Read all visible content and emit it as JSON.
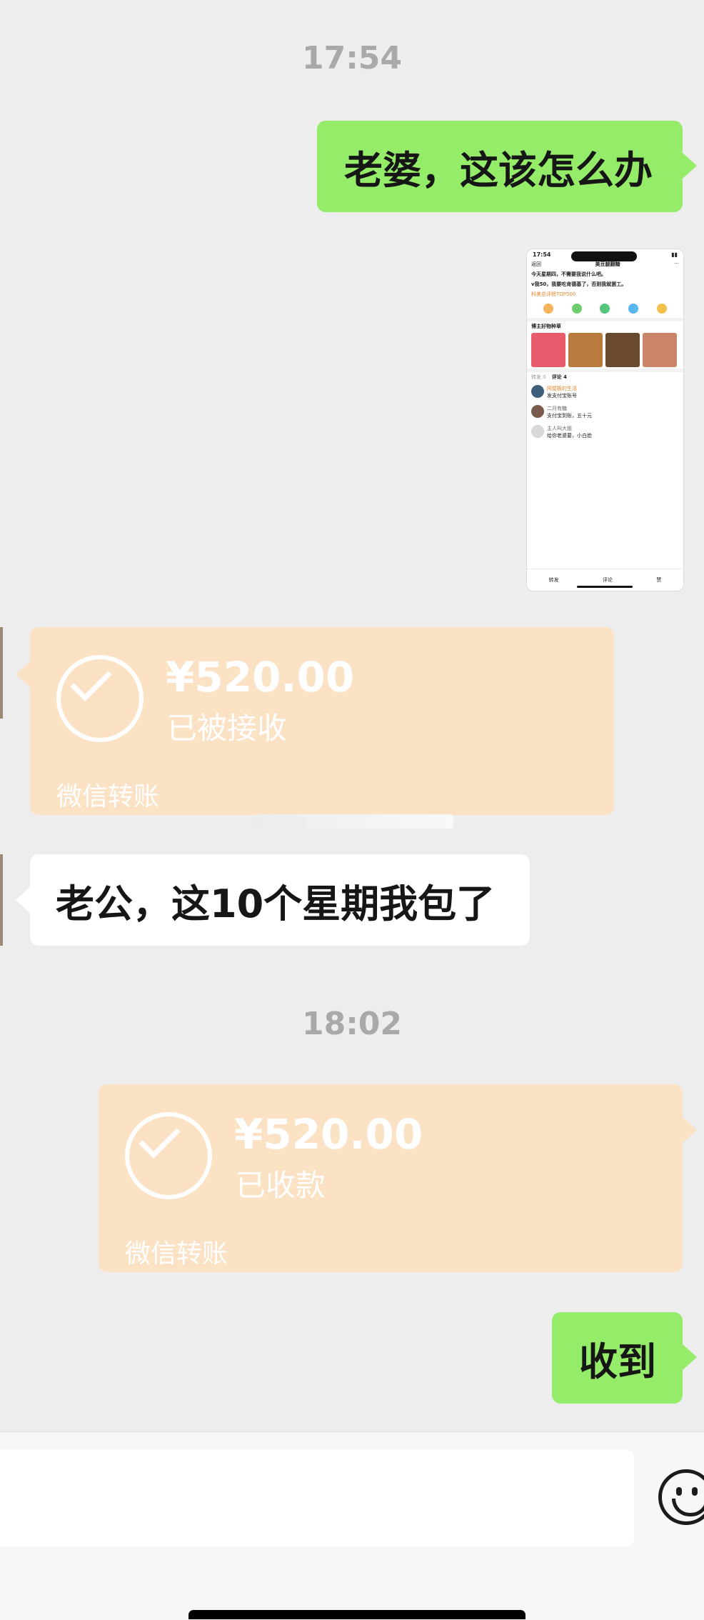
{
  "timestamps": [
    "17:54",
    "18:02"
  ],
  "messages": {
    "m1": "老婆，这该怎么办",
    "m3": "老公，这10个星期我包了",
    "m5": "收到"
  },
  "transfers": [
    {
      "amount": "¥520.00",
      "status": "已被接收",
      "label": "微信转账"
    },
    {
      "amount": "¥520.00",
      "status": "已收款",
      "label": "微信转账"
    }
  ],
  "shared_screenshot": {
    "status_time": "17:54",
    "back": "返回",
    "author": "美豆腿翻糖",
    "post_line1": "今天星期四，不需要我说什么吧。",
    "post_line2": "v我50，我要吃肯德基了，否则我就罢工。",
    "rank_tag": "科美总评榜TOP500",
    "section": "博主好物种草",
    "tabs": [
      "转发 0",
      "评论 4"
    ],
    "comments": [
      {
        "name": "阿壁板的生活",
        "text": "发支付宝账号"
      },
      {
        "name": "二月有糖",
        "text": "支付宝到账，五十元"
      },
      {
        "name": "主人叫大姐",
        "text": "给你老婆要，小白脸"
      }
    ],
    "bottom": [
      "转发",
      "评论",
      "赞"
    ]
  },
  "colors": {
    "background": "#ededed",
    "green_bubble": "#95ec69",
    "transfer_bg": "#fce2c5",
    "timestamp": "#a9a9a9"
  },
  "icons": [
    "check-icon",
    "emoji-icon"
  ]
}
